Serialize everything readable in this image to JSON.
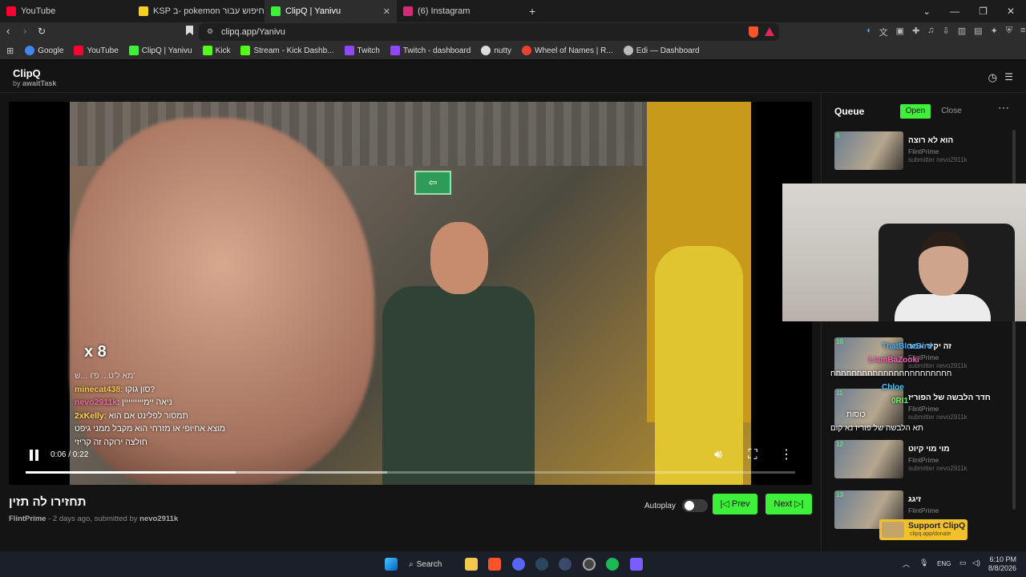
{
  "browser": {
    "tabs": [
      {
        "label": "YouTube",
        "color": "#ff0033"
      },
      {
        "label": "KSP ב- pokemon תוצאות חיפוש עבור",
        "color": "#f5d020"
      },
      {
        "label": "ClipQ | Yanivu",
        "color": "#3ff03a",
        "active": true
      },
      {
        "label": "(6) Instagram",
        "color": "#d62976"
      }
    ],
    "url": "clipq.app/Yanivu",
    "bookmarks": [
      {
        "label": "Google",
        "color": "#4285f4"
      },
      {
        "label": "YouTube",
        "color": "#ff0033"
      },
      {
        "label": "ClipQ | Yanivu",
        "color": "#3ff03a"
      },
      {
        "label": "Kick",
        "color": "#53fc18"
      },
      {
        "label": "Stream - Kick Dashb...",
        "color": "#53fc18"
      },
      {
        "label": "Twitch",
        "color": "#9146ff"
      },
      {
        "label": "Twitch - dashboard",
        "color": "#9146ff"
      },
      {
        "label": "nutty",
        "color": "#dddddd"
      },
      {
        "label": "Wheel of Names | R...",
        "color": "#e9432f"
      },
      {
        "label": "Edi — Dashboard",
        "color": "#bbbbbb"
      }
    ]
  },
  "app": {
    "name": "ClipQ",
    "by_prefix": "by",
    "by_name": "awaitTask"
  },
  "video": {
    "overlay_multiplier": "x 8",
    "time": "0:06 / 0:22",
    "progress": 0.273,
    "buffered": 0.47,
    "chat": [
      {
        "user": "",
        "text": "מא ל'ט... פ'ו ...ש'"
      },
      {
        "user": "minecat438",
        "text": ": סון גוקו?"
      },
      {
        "user": "nevo2911k",
        "text": ": ניאה יימייייייייין"
      },
      {
        "user": "2xKelly",
        "text": ": תמסור לפלינט אם הוא"
      },
      {
        "user": "",
        "text": "מוצא אחיופי או מזרחי הוא מקבל ממני גיפט"
      },
      {
        "user": "",
        "text": "חולצה ירוקה זה קריזי"
      }
    ]
  },
  "clip": {
    "title": "תחזירו לה תזין",
    "author": "FlintPrime",
    "meta_middle": " - 2 days ago, submitted by ",
    "submitter": "nevo2911k"
  },
  "controls": {
    "autoplay_label": "Autoplay",
    "autoplay_on": false,
    "prev_label": "Prev",
    "next_label": "Next"
  },
  "queue": {
    "heading": "Queue",
    "open_label": "Open",
    "close_label": "Close",
    "items": [
      {
        "num": "6",
        "title": "הוא לא רוצה",
        "author": "FlintPrime",
        "submitter": "submitter nevo2911k"
      },
      {
        "num": "10",
        "title": "זה יקיר אמר",
        "author": "FlintPrime",
        "submitter": "submitter nevo2911k"
      },
      {
        "num": "11",
        "title": "חדר הלבשה של הפוריז",
        "author": "FlintPrime",
        "submitter": "submitter nevo2911k"
      },
      {
        "num": "12",
        "title": "מוי מוי קיוט",
        "author": "FlintPrime",
        "submitter": "submitter nevo2911k"
      },
      {
        "num": "13",
        "title": "זיגג",
        "author": "FlintPrime",
        "submitter": ""
      }
    ]
  },
  "overlay_chat": [
    {
      "user": "ThatBlueBird",
      "text": ""
    },
    {
      "user": "LiamBaZooki",
      "text": ""
    },
    {
      "user": "",
      "text": "חחחחחחחחחחחחחחחחחחחחחחח"
    },
    {
      "user": "Chloe",
      "text": ""
    },
    {
      "user": "0RI1",
      "text": ""
    },
    {
      "user": "",
      "text": "כוסות"
    },
    {
      "user": "",
      "text": "תא הלבשה של פוריז נא קום"
    }
  ],
  "support": {
    "label": "Support ClipQ",
    "url": "clipq.app/donate"
  },
  "taskbar": {
    "search_label": "Search",
    "lang": "ENG",
    "time": "6:10 PM",
    "date": "8/8/2026"
  }
}
